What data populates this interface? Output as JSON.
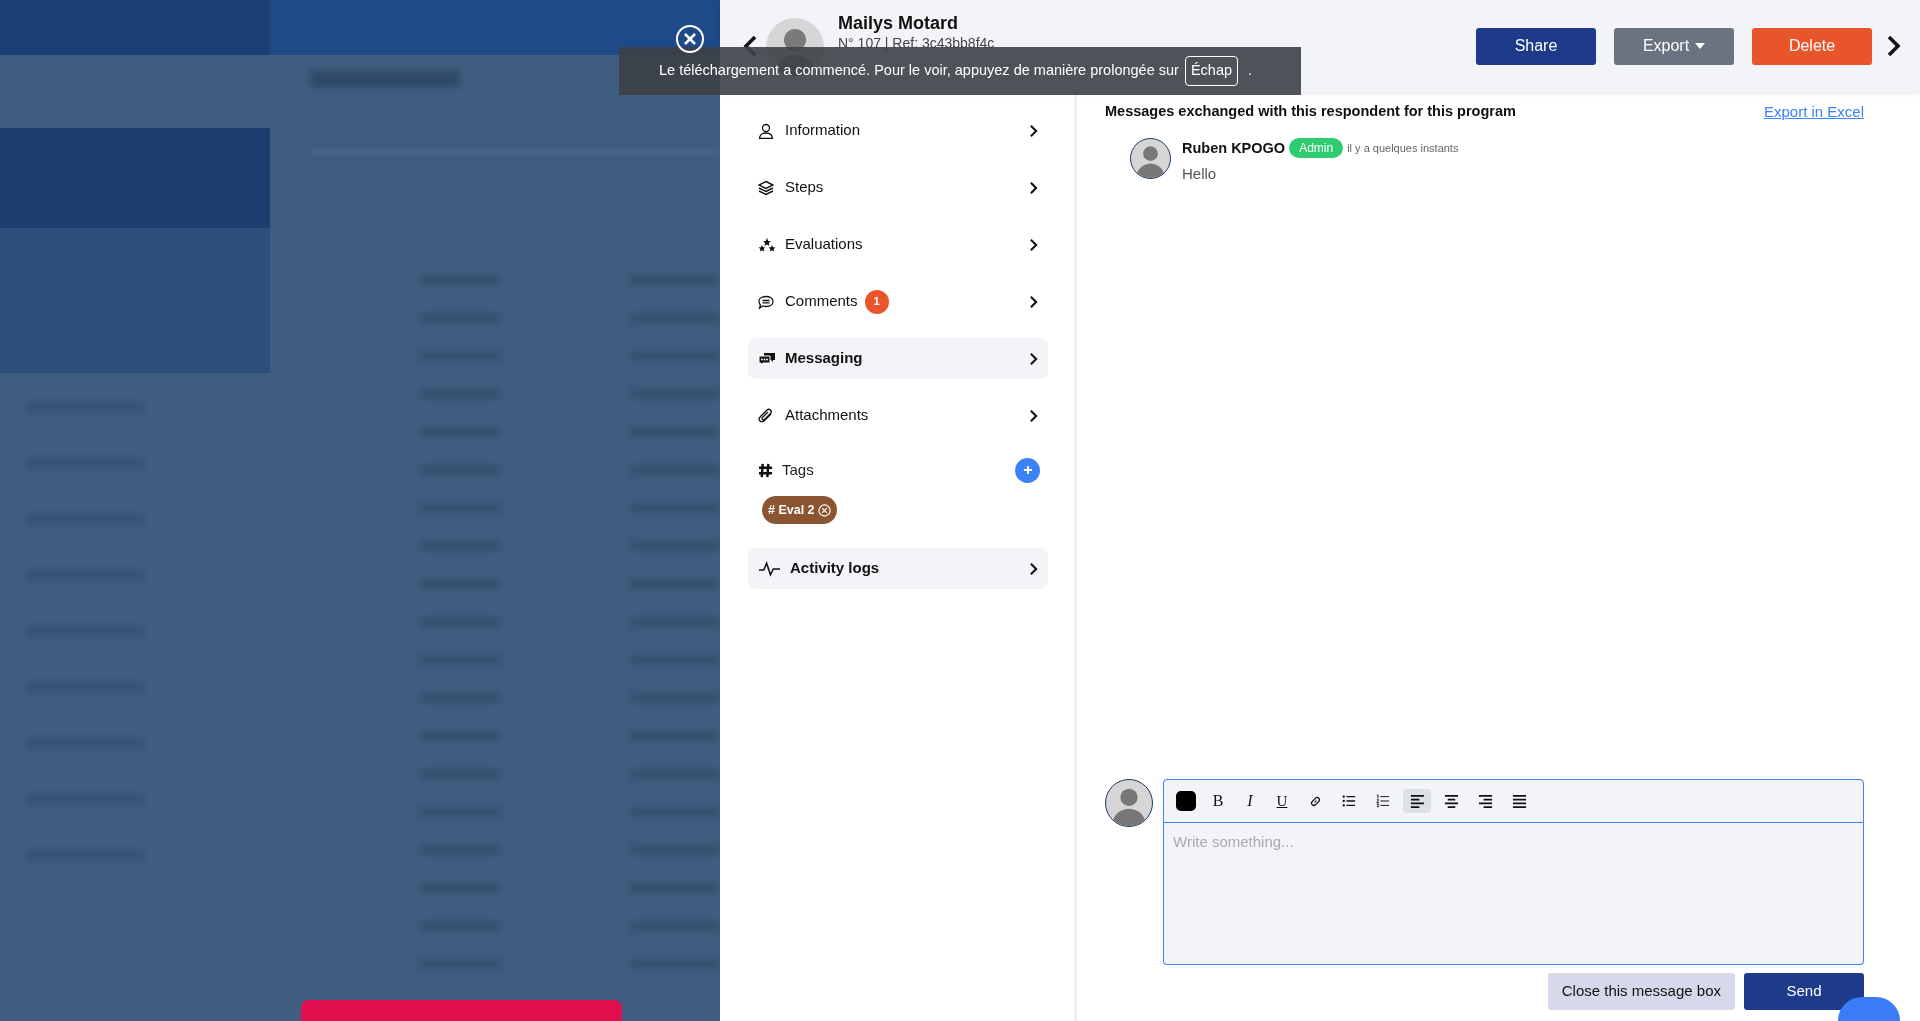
{
  "header": {
    "name": "Mailys Motard",
    "subtitle": "N° 107 | Ref: 3c43bb8f4c"
  },
  "toast": {
    "text": "Le téléchargement a commencé. Pour le voir, appuyez de manière prolongée sur",
    "key": "Échap",
    "end": "."
  },
  "actions": [
    {
      "label": "Share",
      "kind": "primary"
    },
    {
      "label": "Export",
      "kind": "dropdown"
    },
    {
      "label": "Delete",
      "kind": "danger"
    }
  ],
  "menu": [
    {
      "label": "Information",
      "kind": "person",
      "selected": false
    },
    {
      "label": "Steps",
      "kind": "layers",
      "selected": false
    },
    {
      "label": "Evaluations",
      "kind": "stars",
      "selected": false
    },
    {
      "label": "Comments",
      "kind": "comment",
      "badge": "1",
      "selected": false
    },
    {
      "label": "Messaging",
      "kind": "chat",
      "selected": true
    },
    {
      "label": "Attachments",
      "kind": "clip",
      "selected": false
    }
  ],
  "tags": {
    "label": "Tags",
    "items": [
      {
        "label": "# Eval 2",
        "color": "#8a5530"
      }
    ]
  },
  "activity_logs": {
    "label": "Activity logs"
  },
  "messages": {
    "title": "Messages exchanged with this respondent for this program",
    "export_link": "Export in Excel",
    "items": [
      {
        "author": "Ruben KPOGO",
        "role": "Admin",
        "time": "il y a quelques instants",
        "text": "Hello"
      }
    ]
  },
  "composer": {
    "placeholder": "Write something...",
    "toolbar": [
      {
        "kind": "color",
        "selected": false
      },
      {
        "kind": "bold",
        "label": "B",
        "selected": false
      },
      {
        "kind": "italic",
        "label": "I",
        "selected": false
      },
      {
        "kind": "underline",
        "label": "U",
        "selected": false
      },
      {
        "kind": "link",
        "selected": false
      },
      {
        "kind": "bullets",
        "selected": false
      },
      {
        "kind": "numbers",
        "selected": false
      },
      {
        "kind": "align-left",
        "selected": true
      },
      {
        "kind": "align-center",
        "selected": false
      },
      {
        "kind": "align-right",
        "selected": false
      },
      {
        "kind": "justify",
        "selected": false
      }
    ],
    "buttons": [
      {
        "label": "Close this message box",
        "kind": "secondary"
      },
      {
        "label": "Send",
        "kind": "primary"
      }
    ]
  }
}
